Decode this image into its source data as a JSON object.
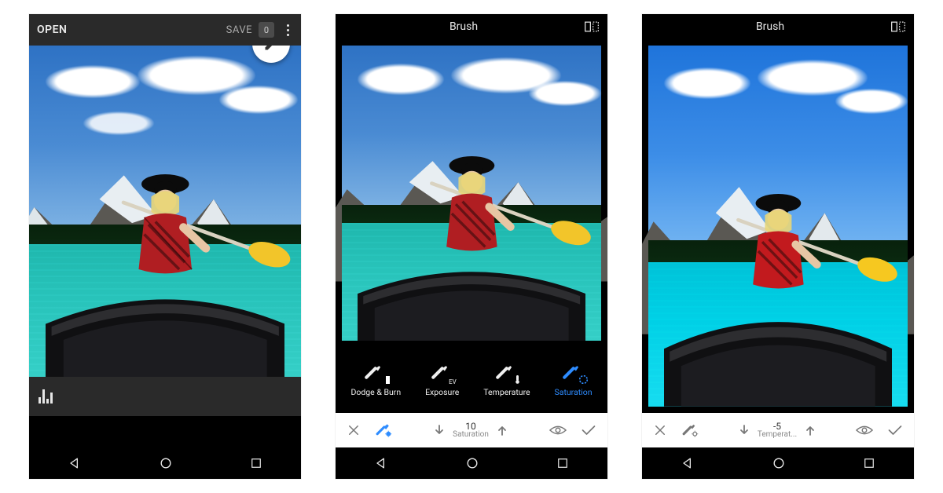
{
  "main": {
    "open_label": "OPEN",
    "save_label": "SAVE",
    "badge_value": "0"
  },
  "brush": {
    "title": "Brush",
    "tools": [
      {
        "label": "Dodge & Burn"
      },
      {
        "label": "Exposure",
        "sub": "EV"
      },
      {
        "label": "Temperature"
      },
      {
        "label": "Saturation"
      }
    ],
    "selected_tool_index": 3
  },
  "valbar_phone2": {
    "value": "10",
    "label": "Saturation",
    "brush_selected": true
  },
  "valbar_phone3": {
    "value": "-5",
    "label": "Temperat...",
    "brush_selected": false
  }
}
